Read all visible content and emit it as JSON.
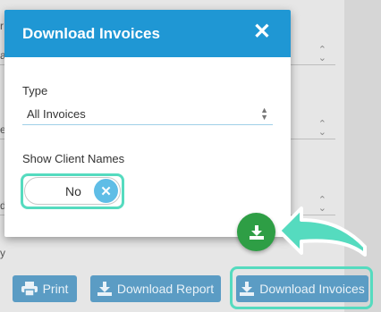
{
  "modal": {
    "title": "Download Invoices",
    "close_glyph": "✕",
    "type_label": "Type",
    "type_value": "All Invoices",
    "show_names_label": "Show Client Names",
    "toggle_value": "No",
    "toggle_glyph": "✕"
  },
  "background": {
    "labels": [
      "r",
      "a",
      "e",
      "d",
      "y"
    ]
  },
  "toolbar": {
    "print_label": "Print",
    "download_report_label": "Download Report",
    "download_invoices_label": "Download Invoices"
  },
  "icons": {
    "close": "close-icon",
    "print": "printer-icon",
    "download": "download-icon",
    "arrow": "arrow-left-icon"
  },
  "colors": {
    "modal_header": "#1f97d4",
    "toolbar_button": "#5b9cc4",
    "highlight": "#55dbbf",
    "fab": "#2e9e45"
  }
}
